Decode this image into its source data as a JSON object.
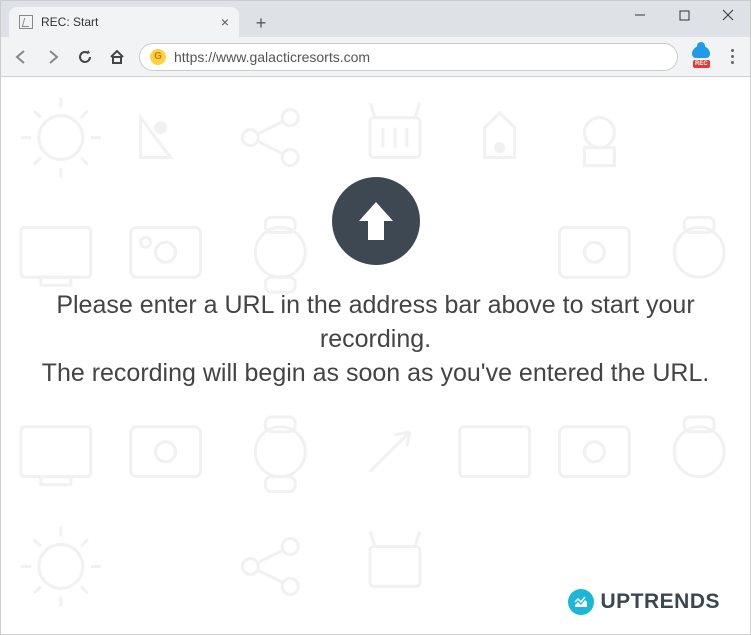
{
  "tab": {
    "title": "REC: Start"
  },
  "address": {
    "url": "https://www.galacticresorts.com",
    "site_icon_letter": "G"
  },
  "extension": {
    "rec_label": "REC"
  },
  "message": {
    "line1": "Please enter a URL in the address bar above to start your recording.",
    "line2": "The recording will begin as soon as you've entered the URL."
  },
  "brand": {
    "name": "UPTRENDS"
  }
}
